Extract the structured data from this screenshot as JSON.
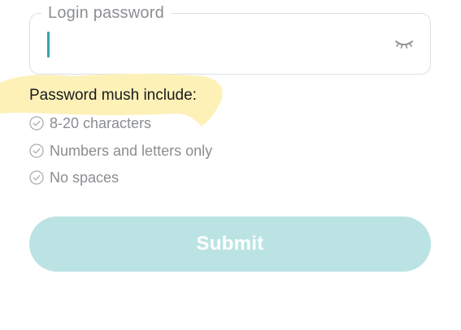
{
  "password_field": {
    "label": "Login password",
    "value": "",
    "visibility_toggle_icon": "eye-closed-icon"
  },
  "rules": {
    "heading": "Password mush include:",
    "highlight_color": "#fdf1b8",
    "items": [
      {
        "icon": "check-circle-icon",
        "label": "8-20 characters"
      },
      {
        "icon": "check-circle-icon",
        "label": "Numbers and letters only"
      },
      {
        "icon": "check-circle-icon",
        "label": "No spaces"
      }
    ]
  },
  "submit": {
    "label": "Submit",
    "color": "#bce3e4",
    "enabled": false
  },
  "colors": {
    "caret": "#3aa3a8",
    "muted_text": "#8a8d91",
    "field_border": "#dcdfe3"
  }
}
